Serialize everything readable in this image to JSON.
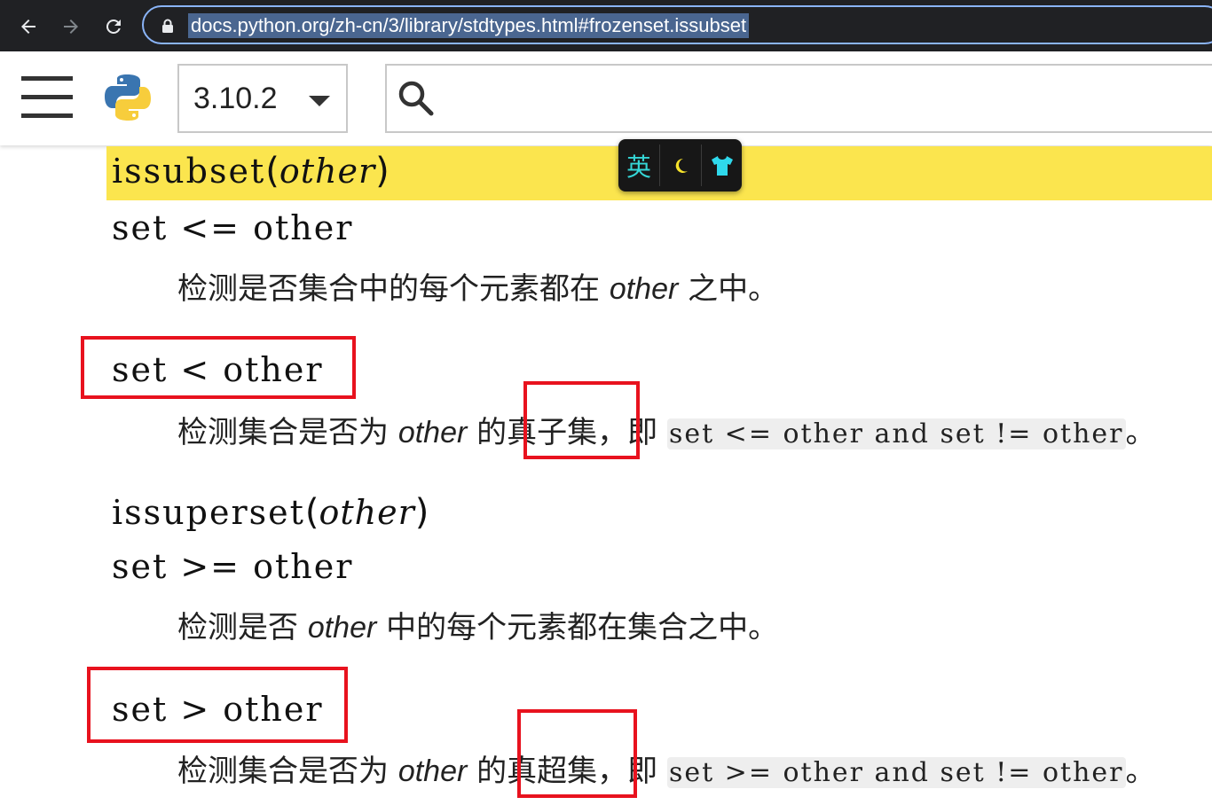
{
  "browser": {
    "url": "docs.python.org/zh-cn/3/library/stdtypes.html#frozenset.issubset"
  },
  "header": {
    "version": "3.10.2"
  },
  "extension": {
    "lang_label": "英"
  },
  "entries": [
    {
      "sig": "issubset",
      "param": "other"
    },
    {
      "sig": "set <= other"
    },
    {
      "desc_pre": "检测是否集合中的每个元素都在 ",
      "desc_param": "other",
      "desc_post": " 之中。"
    },
    {
      "sig": "set < other"
    },
    {
      "desc_pre": "检测集合是否为 ",
      "desc_param": "other",
      "desc_mid": " 的真子集，即 ",
      "code": "set <= other and set != other",
      "desc_post": "。"
    },
    {
      "sig": "issuperset",
      "param": "other"
    },
    {
      "sig": "set >= other"
    },
    {
      "desc_pre": "检测是否 ",
      "desc_param": "other",
      "desc_post": " 中的每个元素都在集合之中。"
    },
    {
      "sig": "set > other"
    },
    {
      "desc_pre": "检测集合是否为 ",
      "desc_param": "other",
      "desc_mid": " 的真超集，即 ",
      "code": "set >= other and set != other",
      "desc_post": "。"
    }
  ],
  "colors": {
    "highlight": "#fbe54e",
    "annotation_box": "#e8121e",
    "browser_bg": "#202124",
    "omnibox_border": "#8ab4f8"
  }
}
